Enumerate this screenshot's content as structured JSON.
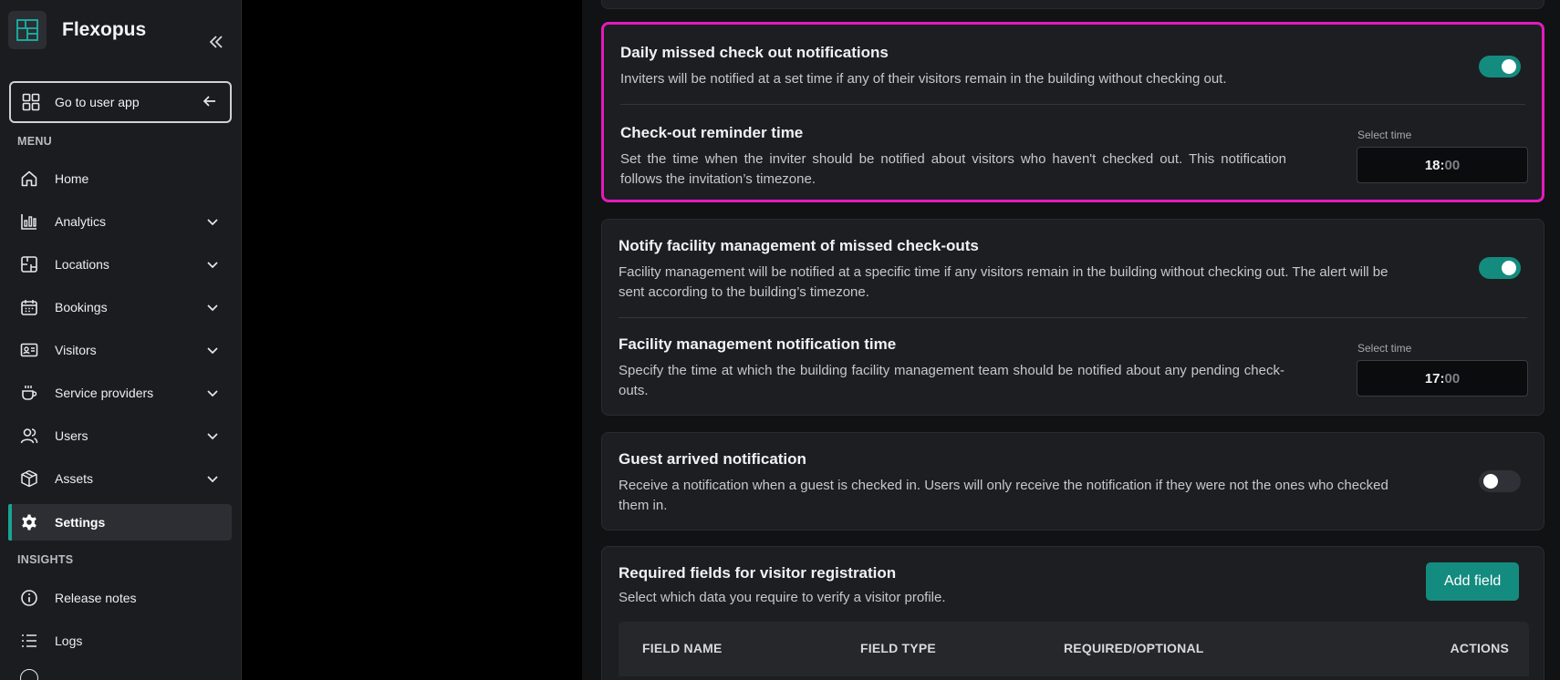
{
  "sidebar": {
    "brand": "Flexopus",
    "go_to_user_app": "Go to user app",
    "menu_title": "MENU",
    "items": [
      {
        "label": "Home"
      },
      {
        "label": "Analytics"
      },
      {
        "label": "Locations"
      },
      {
        "label": "Bookings"
      },
      {
        "label": "Visitors"
      },
      {
        "label": "Service providers"
      },
      {
        "label": "Users"
      },
      {
        "label": "Assets"
      },
      {
        "label": "Settings"
      }
    ],
    "insights_title": "INSIGHTS",
    "insights_items": [
      {
        "label": "Release notes"
      },
      {
        "label": "Logs"
      }
    ]
  },
  "main": {
    "missed_checkout": {
      "title": "Daily missed check out notifications",
      "description": "Inviters will be notified at a set time if any of their visitors remain in the building without checking out.",
      "enabled": true
    },
    "reminder_time": {
      "title": "Check-out reminder time",
      "description": "Set the time when the inviter should be notified about visitors who haven't checked out. This notification follows the invitation’s timezone.",
      "time_label": "Select time",
      "hour": "18",
      "minute": "00"
    },
    "facility_missed": {
      "title": "Notify facility management of missed check-outs",
      "description": "Facility management will be notified at a specific time if any visitors remain in the building without checking out. The alert will be sent according to the building’s timezone.",
      "enabled": true
    },
    "facility_time": {
      "title": "Facility management notification time",
      "description": "Specify the time at which the building facility management team should be notified about any pending check-outs.",
      "time_label": "Select time",
      "hour": "17",
      "minute": "00"
    },
    "guest_arrived": {
      "title": "Guest arrived notification",
      "description": "Receive a notification when a guest is checked in. Users will only receive the notification if they were not the ones who checked them in.",
      "enabled": false
    },
    "required_fields": {
      "title": "Required fields for visitor registration",
      "description": "Select which data you require to verify a visitor profile.",
      "add_button": "Add field",
      "columns": [
        "FIELD NAME",
        "FIELD TYPE",
        "REQUIRED/OPTIONAL",
        "ACTIONS"
      ]
    }
  },
  "colors": {
    "accent": "#148b7f",
    "highlight": "#e21bbd",
    "sidebar_bg": "#1b1c1f",
    "card_bg": "#1d1e21"
  }
}
